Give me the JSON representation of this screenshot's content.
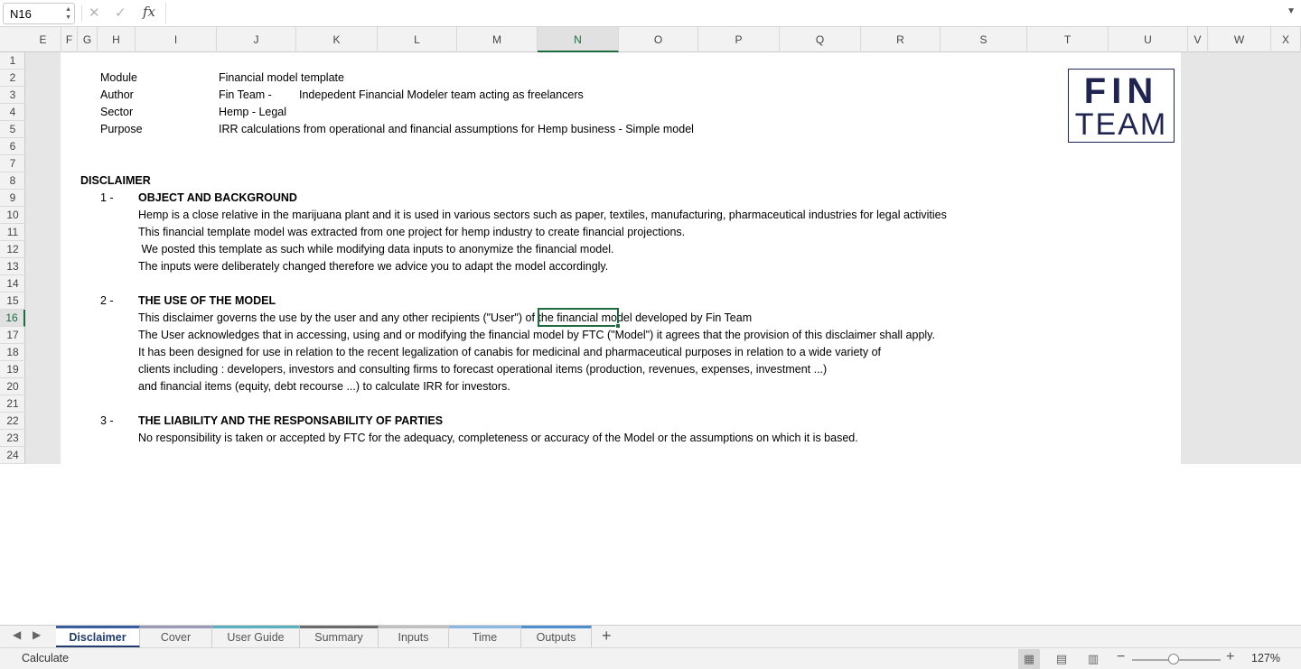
{
  "formula_bar": {
    "name_box": "N16",
    "cancel_icon": "✕",
    "enter_icon": "✓",
    "fx_label": "fx",
    "formula_value": ""
  },
  "columns": [
    "E",
    "F",
    "G",
    "H",
    "I",
    "J",
    "K",
    "L",
    "M",
    "N",
    "O",
    "P",
    "Q",
    "R",
    "S",
    "T",
    "U",
    "V",
    "W",
    "X"
  ],
  "rows": [
    "1",
    "2",
    "3",
    "4",
    "5",
    "6",
    "7",
    "8",
    "9",
    "10",
    "11",
    "12",
    "13",
    "14",
    "15",
    "16",
    "17",
    "18",
    "19",
    "20",
    "21",
    "22",
    "23",
    "24"
  ],
  "selected_cell": "N16",
  "header_block": {
    "module_label": "Module",
    "module_value": "Financial model template",
    "author_label": "Author",
    "author_value": "Fin Team -",
    "author_desc": "Indepedent Financial Modeler team acting as freelancers",
    "sector_label": "Sector",
    "sector_value": "Hemp - Legal",
    "purpose_label": "Purpose",
    "purpose_value": "IRR calculations from operational and financial assumptions for Hemp business - Simple model"
  },
  "logo": {
    "line1": "FIN",
    "line2": "TEAM"
  },
  "disclaimer": {
    "title": "DISCLAIMER",
    "s1_num": "1 -",
    "s1_title": "OBJECT AND BACKGROUND",
    "s1_lines": [
      "Hemp is a close relative in the marijuana plant and it is used in various sectors such as paper, textiles, manufacturing, pharmaceutical industries for legal activities",
      "This financial template model was extracted from one project for hemp industry to create financial projections.",
      " We posted this template as such while modifying data inputs to anonymize the financial model.",
      "The inputs were deliberately changed therefore we advice you to adapt the model accordingly."
    ],
    "s2_num": "2 -",
    "s2_title": "THE USE OF THE MODEL",
    "s2_lines": [
      "This disclaimer governs the use by the user and any other recipients (\"User\") of the financial model developed by Fin Team",
      "The User acknowledges that in accessing, using and or modifying the financial model by FTC (\"Model\") it agrees that the provision of this disclaimer shall apply.",
      "It has been designed for use in relation to the recent legalization of canabis for medicinal and pharmaceutical purposes in relation to a wide variety of",
      "clients including : developers, investors and consulting firms to forecast operational items (production, revenues, expenses, investment ...)",
      "and financial items (equity, debt recourse ...) to calculate IRR for investors."
    ],
    "s3_num": "3 -",
    "s3_title": "THE LIABILITY AND THE RESPONSABILITY OF PARTIES",
    "s3_lines": [
      "No responsibility is taken or accepted by FTC for the adequacy, completeness or accuracy of the Model or the assumptions on which it is based."
    ]
  },
  "sheet_tabs": [
    {
      "label": "Disclaimer",
      "active": true,
      "color": "#3a5fa0"
    },
    {
      "label": "Cover",
      "active": false,
      "color": "#9a9ab8"
    },
    {
      "label": "User Guide",
      "active": false,
      "color": "#5ab0c0"
    },
    {
      "label": "Summary",
      "active": false,
      "color": "#6a6a6a"
    },
    {
      "label": "Inputs",
      "active": false,
      "color": "#c0c0c0"
    },
    {
      "label": "Time",
      "active": false,
      "color": "#8ab8e0"
    },
    {
      "label": "Outputs",
      "active": false,
      "color": "#4a90d0"
    }
  ],
  "add_sheet": "+",
  "tab_prev": "◀",
  "tab_next": "▶",
  "status": {
    "mode": "Calculate",
    "zoom_minus": "−",
    "zoom_plus": "+",
    "zoom_level": "127%",
    "zoom_fraction": 0.47
  }
}
